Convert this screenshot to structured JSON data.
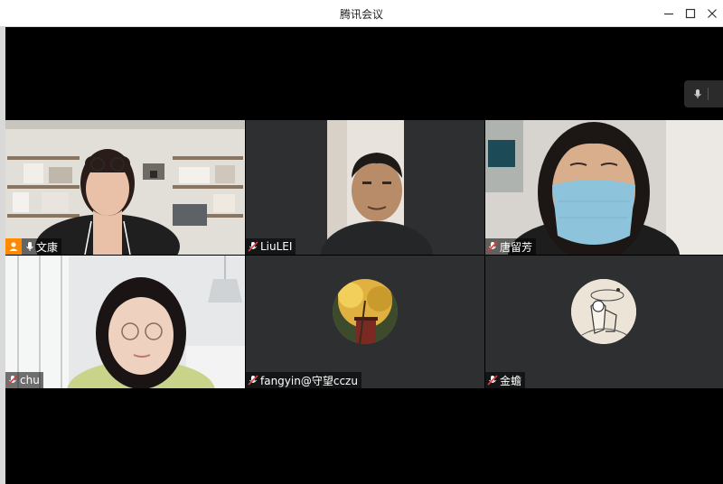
{
  "window": {
    "title": "腾讯会议"
  },
  "icons": {
    "minimize": "minimize-icon",
    "maximize": "maximize-icon",
    "close": "close-icon",
    "mic": "microphone-icon",
    "muted": "muted-mic-icon",
    "host": "host-badge-icon"
  },
  "colors": {
    "host_badge": "#ff8a00",
    "tile_bg": "#2d2f31",
    "muted_red": "#e33b3b"
  },
  "participants": [
    {
      "name": "文康",
      "host": true,
      "muted": false
    },
    {
      "name": "LiuLEI",
      "host": false,
      "muted": true
    },
    {
      "name": "唐留芳",
      "host": false,
      "muted": true
    },
    {
      "name": "chu",
      "host": false,
      "muted": true
    },
    {
      "name": "fangyin@守望cczu",
      "host": false,
      "muted": true
    },
    {
      "name": "金蟾",
      "host": false,
      "muted": true
    }
  ]
}
